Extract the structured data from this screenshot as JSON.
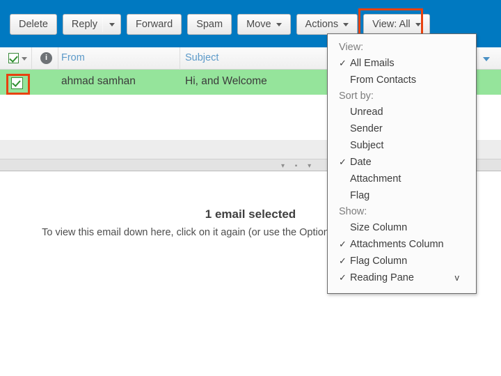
{
  "toolbar": {
    "buttons": [
      {
        "label": "Delete",
        "name": "delete-button",
        "caret": false
      },
      {
        "label": "Reply",
        "name": "reply-button",
        "caret": true
      },
      {
        "label": "Forward",
        "name": "forward-button",
        "caret": false
      },
      {
        "label": "Spam",
        "name": "spam-button",
        "caret": false
      },
      {
        "label": "Move",
        "name": "move-button",
        "caret": true
      },
      {
        "label": "Actions",
        "name": "actions-button",
        "caret": true
      }
    ],
    "view_button": "View: All"
  },
  "list_header": {
    "from": "From",
    "subject": "Subject",
    "attachment_icon": "i"
  },
  "message": {
    "from": "ahmad samhan",
    "subject": "Hi, and Welcome"
  },
  "reading_pane": {
    "title": "1 email selected",
    "subtitle": "To view this email down here, click on it again (or use the Options menu to change the inbox)."
  },
  "menu": {
    "sections": [
      {
        "label": "View:",
        "items": [
          {
            "label": "All Emails",
            "checked": true
          },
          {
            "label": "From Contacts",
            "checked": false
          }
        ]
      },
      {
        "label": "Sort by:",
        "items": [
          {
            "label": "Unread",
            "checked": false
          },
          {
            "label": "Sender",
            "checked": false
          },
          {
            "label": "Subject",
            "checked": false
          },
          {
            "label": "Date",
            "checked": true
          },
          {
            "label": "Attachment",
            "checked": false
          },
          {
            "label": "Flag",
            "checked": false
          }
        ]
      },
      {
        "label": "Show:",
        "items": [
          {
            "label": "Size Column",
            "checked": false
          },
          {
            "label": "Attachments Column",
            "checked": true
          },
          {
            "label": "Flag Column",
            "checked": true
          },
          {
            "label": "Reading Pane",
            "checked": true,
            "submenu": "v"
          }
        ]
      }
    ],
    "check_glyph": "✓"
  },
  "colors": {
    "toolbar_bg": "#0079c1",
    "highlight": "#e8420f",
    "selected_row": "#95e49b",
    "header_link": "#5c9ac9"
  }
}
